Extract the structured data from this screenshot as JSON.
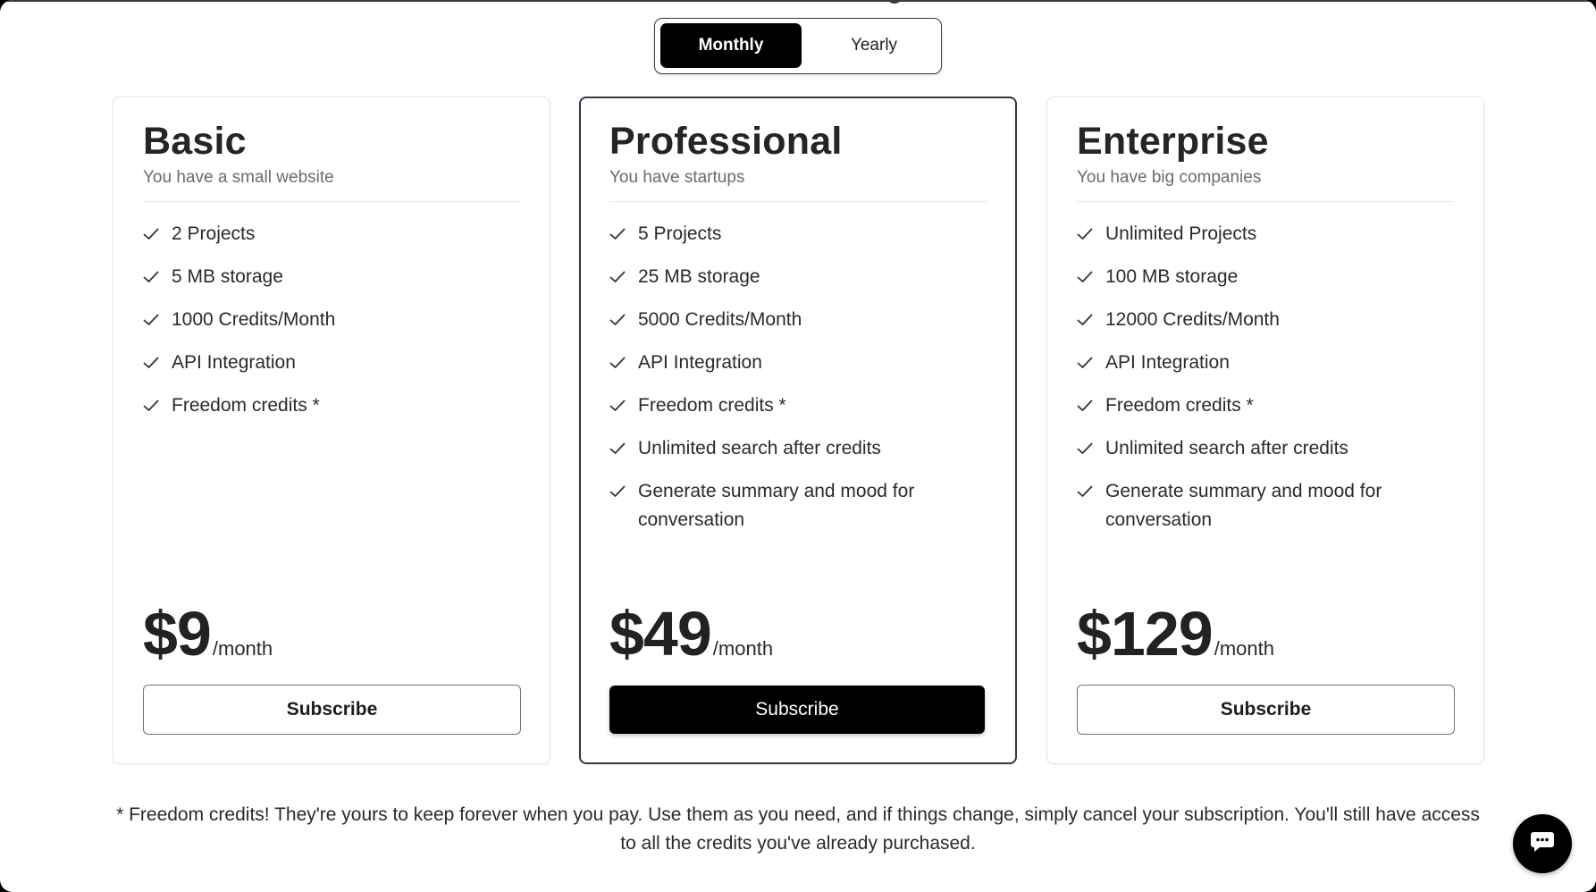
{
  "billing_toggle": {
    "options": [
      "Monthly",
      "Yearly"
    ],
    "selected": "Monthly"
  },
  "plans": [
    {
      "name": "Basic",
      "description": "You have a small website",
      "features": [
        "2 Projects",
        "5 MB storage",
        "1000 Credits/Month",
        "API Integration",
        "Freedom credits *"
      ],
      "price": "$9",
      "period": "/month",
      "cta": "Subscribe",
      "featured": false
    },
    {
      "name": "Professional",
      "description": "You have startups",
      "features": [
        "5 Projects",
        "25 MB storage",
        "5000 Credits/Month",
        "API Integration",
        "Freedom credits *",
        "Unlimited search after credits",
        "Generate summary and mood for conversation"
      ],
      "price": "$49",
      "period": "/month",
      "cta": "Subscribe",
      "featured": true
    },
    {
      "name": "Enterprise",
      "description": "You have big companies",
      "features": [
        "Unlimited Projects",
        "100 MB storage",
        "12000 Credits/Month",
        "API Integration",
        "Freedom credits *",
        "Unlimited search after credits",
        "Generate summary and mood for conversation"
      ],
      "price": "$129",
      "period": "/month",
      "cta": "Subscribe",
      "featured": false
    }
  ],
  "footnote": "* Freedom credits! They're yours to keep forever when you pay. Use them as you need, and if things change, simply cancel your subscription. You'll still have access to all the credits you've already purchased.",
  "chat_widget": {
    "icon": "chat-bubble-icon"
  },
  "colors": {
    "accent": "#000000",
    "text": "#1f1f1f",
    "muted": "#6b6b6b",
    "card_border": "#e4e4e7",
    "featured_border": "#2f3a47"
  }
}
